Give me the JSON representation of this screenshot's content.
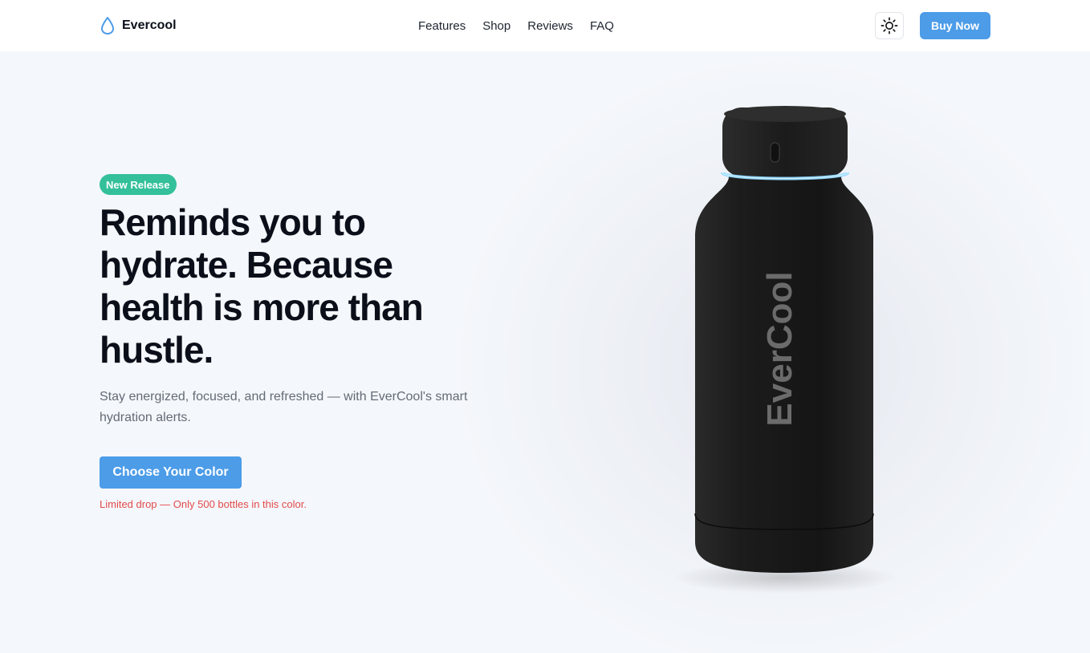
{
  "header": {
    "brand_name": "Evercool",
    "nav": [
      {
        "label": "Features"
      },
      {
        "label": "Shop"
      },
      {
        "label": "Reviews"
      },
      {
        "label": "FAQ"
      }
    ],
    "buy_label": "Buy Now"
  },
  "hero": {
    "badge": "New Release",
    "headline": "Reminds you to hydrate. Because health is more than hustle.",
    "subtext": "Stay energized, focused, and refreshed — with EverCool's smart hydration alerts.",
    "cta_label": "Choose Your Color",
    "limited_note": "Limited drop — Only 500 bottles in this color.",
    "bottle_text": "EverCool"
  },
  "colors": {
    "accent": "#4c9ce8",
    "badge": "#33c09b",
    "warning": "#e24b4b",
    "bottle": "#1a1a1a",
    "glow_ring": "#8fd8ff"
  },
  "icons": {
    "brand": "water-drop-icon",
    "theme": "sun-icon"
  }
}
